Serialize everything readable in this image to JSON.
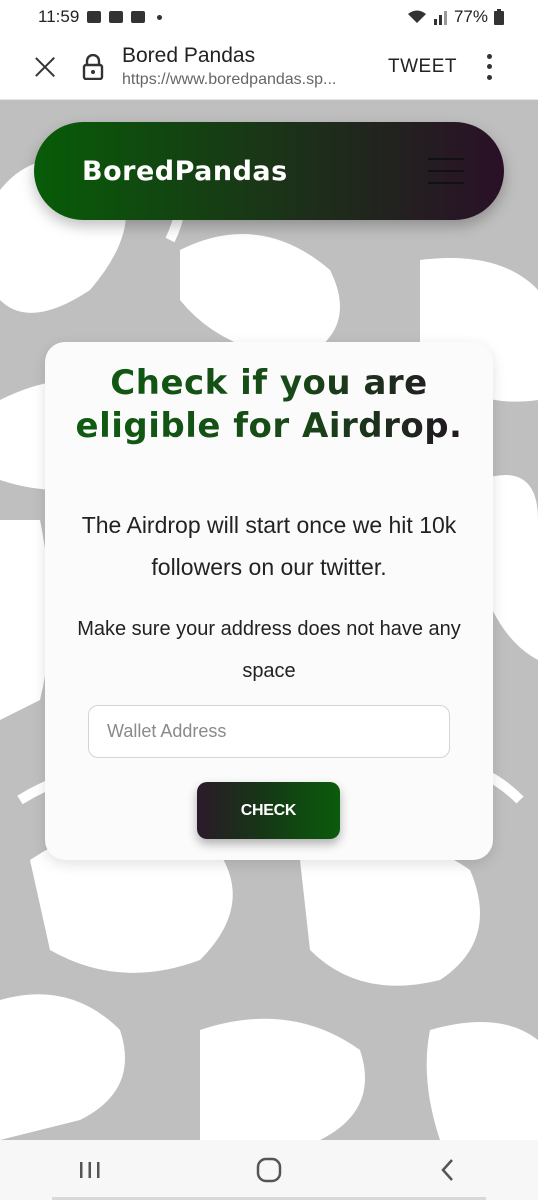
{
  "status_bar": {
    "time": "11:59",
    "battery": "77%",
    "icons": [
      "gallery-icon",
      "discord-icon",
      "discord-icon",
      "dot-icon",
      "wifi-icon",
      "signal-icon",
      "battery-icon"
    ]
  },
  "browser": {
    "title": "Bored Pandas",
    "url": "https://www.boredpandas.sp...",
    "action_label": "TWEET",
    "icons": [
      "close-icon",
      "lock-icon",
      "more-vert-icon"
    ]
  },
  "navbar": {
    "logo": "BoredPandas",
    "menu_icon": "hamburger-icon",
    "gradient": [
      "#075c07",
      "#2a1027"
    ]
  },
  "card": {
    "title": "Check if you are eligible for Airdrop.",
    "subtitle": "The Airdrop will start once we hit 10k followers on our twitter.",
    "note": "Make sure your address does not have any space",
    "input_placeholder": "Wallet Address",
    "input_value": "",
    "button_label": "CHECK"
  },
  "system_nav": {
    "icons": [
      "recents-icon",
      "home-icon",
      "back-icon"
    ]
  },
  "colors": {
    "brand_green": "#075c07",
    "brand_purple": "#2a1027",
    "background_gray": "#c9c9c9"
  }
}
